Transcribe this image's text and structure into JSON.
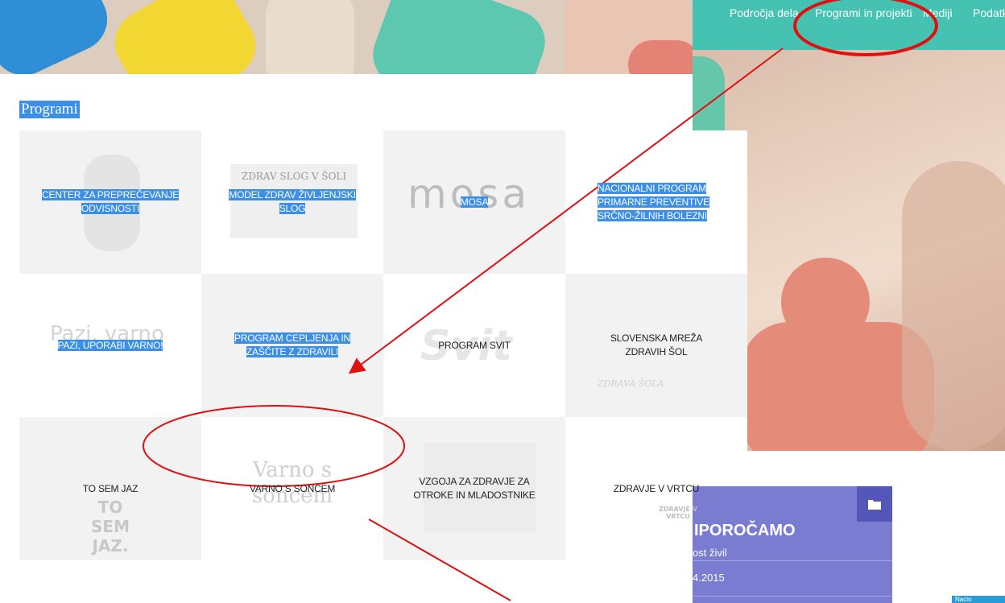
{
  "nav": {
    "items": [
      "Področja dela",
      "Programi in projekti",
      "Mediji",
      "Podatki"
    ]
  },
  "page": {
    "heading": "Programi"
  },
  "tiles": [
    {
      "label": "CENTER ZA PREPREČEVANJE ODVISNOSTI",
      "logo": ""
    },
    {
      "label": "MODEL ZDRAV ŽIVLJENJSKI SLOG",
      "logo": "ZDRAV SLOG V ŠOLI"
    },
    {
      "label": "MOSA",
      "logo": "mosa"
    },
    {
      "label": "NACIONALNI PROGRAM PRIMARNE PREVENTIVE SRČNO-ŽILNIH BOLEZNI",
      "logo": ""
    },
    {
      "label": "PAZI, UPORABI VARNO!",
      "logo": "Pazi, varno"
    },
    {
      "label": "PROGRAM CEPLJENJA IN ZAŠČITE Z ZDRAVILI",
      "logo": ""
    },
    {
      "label": "PROGRAM SVIT",
      "logo": "Svit"
    },
    {
      "label": "SLOVENSKA MREŽA ZDRAVIH ŠOL",
      "logo": "ZDRAVA ŠOLA"
    },
    {
      "label": "TO SEM JAZ",
      "logo": "TO SEM JAZ."
    },
    {
      "label": "VARNO S SONCEM",
      "logo": "Varno s soncem"
    },
    {
      "label": "VZGOJA ZA ZDRAVJE ZA OTROKE IN MLADOSTNIKE",
      "logo": ""
    },
    {
      "label": "ZDRAVJE V VRTCU",
      "logo": "ZDRAVJE V VRTCU"
    }
  ],
  "card": {
    "title": "IPOROČAMO",
    "subtitle": "ost živil",
    "date": "4.2015"
  },
  "badge": {
    "text": "Nacio"
  },
  "colors": {
    "nav": "#45c2b1",
    "highlight": "#3b8fe6",
    "card": "#7a7cd1",
    "annotation": "#e01010"
  }
}
